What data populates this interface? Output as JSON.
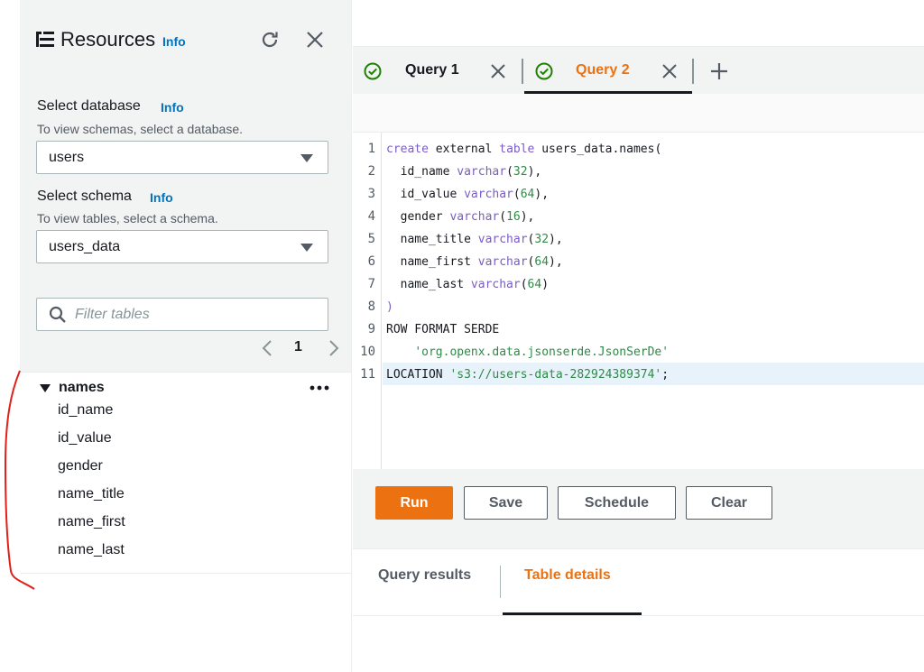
{
  "resources": {
    "title": "Resources",
    "info": "Info",
    "database": {
      "label": "Select database",
      "info": "Info",
      "hint": "To view schemas, select a database.",
      "value": "users"
    },
    "schema": {
      "label": "Select schema",
      "info": "Info",
      "hint": "To view tables, select a schema.",
      "value": "users_data"
    },
    "filter_placeholder": "Filter tables",
    "page": "1",
    "table": {
      "name": "names",
      "columns": [
        "id_name",
        "id_value",
        "gender",
        "name_title",
        "name_first",
        "name_last"
      ]
    }
  },
  "tabs": [
    {
      "label": "Query 1"
    },
    {
      "label": "Query 2"
    }
  ],
  "editor": {
    "line_numbers": [
      "1",
      "2",
      "3",
      "4",
      "5",
      "6",
      "7",
      "8",
      "9",
      "10",
      "11"
    ]
  },
  "buttons": {
    "run": "Run",
    "save": "Save",
    "schedule": "Schedule",
    "clear": "Clear"
  },
  "result_tabs": {
    "query_results": "Query results",
    "table_details": "Table details"
  },
  "colors": {
    "accent": "#ec7211",
    "link": "#0073bb",
    "success": "#1d8102",
    "annotation": "#e0201b"
  }
}
